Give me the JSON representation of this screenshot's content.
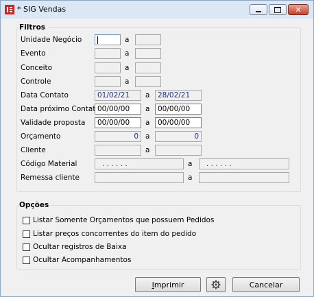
{
  "window": {
    "title": "* SIG Vendas"
  },
  "filtros": {
    "legend": "Filtros",
    "rows": [
      {
        "label": "Unidade Negócio",
        "from": "",
        "sep": "a",
        "to": ""
      },
      {
        "label": "Evento",
        "from": "",
        "sep": "a",
        "to": ""
      },
      {
        "label": "Conceito",
        "from": "",
        "sep": "a",
        "to": ""
      },
      {
        "label": "Controle",
        "from": "",
        "sep": "a",
        "to": ""
      },
      {
        "label": "Data Contato",
        "from": "01/02/21",
        "sep": "a",
        "to": "28/02/21"
      },
      {
        "label": "Data próximo Contato",
        "from": "00/00/00",
        "sep": "a",
        "to": "00/00/00"
      },
      {
        "label": "Validade proposta",
        "from": "00/00/00",
        "sep": "a",
        "to": "00/00/00"
      },
      {
        "label": "Orçamento",
        "from": "0",
        "sep": "a",
        "to": "0"
      },
      {
        "label": "Cliente",
        "from": "",
        "sep": "a",
        "to": ""
      },
      {
        "label": "Código Material",
        "from": ". . . . . .",
        "sep": "a",
        "to": ". . . . . ."
      },
      {
        "label": "Remessa cliente",
        "from": "",
        "sep": "a",
        "to": ""
      }
    ]
  },
  "opcoes": {
    "legend": "Opções",
    "items": [
      {
        "label": "Listar Somente Orçamentos que possuem Pedidos",
        "checked": false
      },
      {
        "label": "Listar preços concorrentes do item do pedido",
        "checked": false
      },
      {
        "label": "Ocultar registros de Baixa",
        "checked": false
      },
      {
        "label": "Ocultar Acompanhamentos",
        "checked": false
      }
    ]
  },
  "buttons": {
    "print_first": "I",
    "print_rest": "mprimir",
    "settings_icon": "gear-icon",
    "cancel_label": "Cancelar"
  }
}
